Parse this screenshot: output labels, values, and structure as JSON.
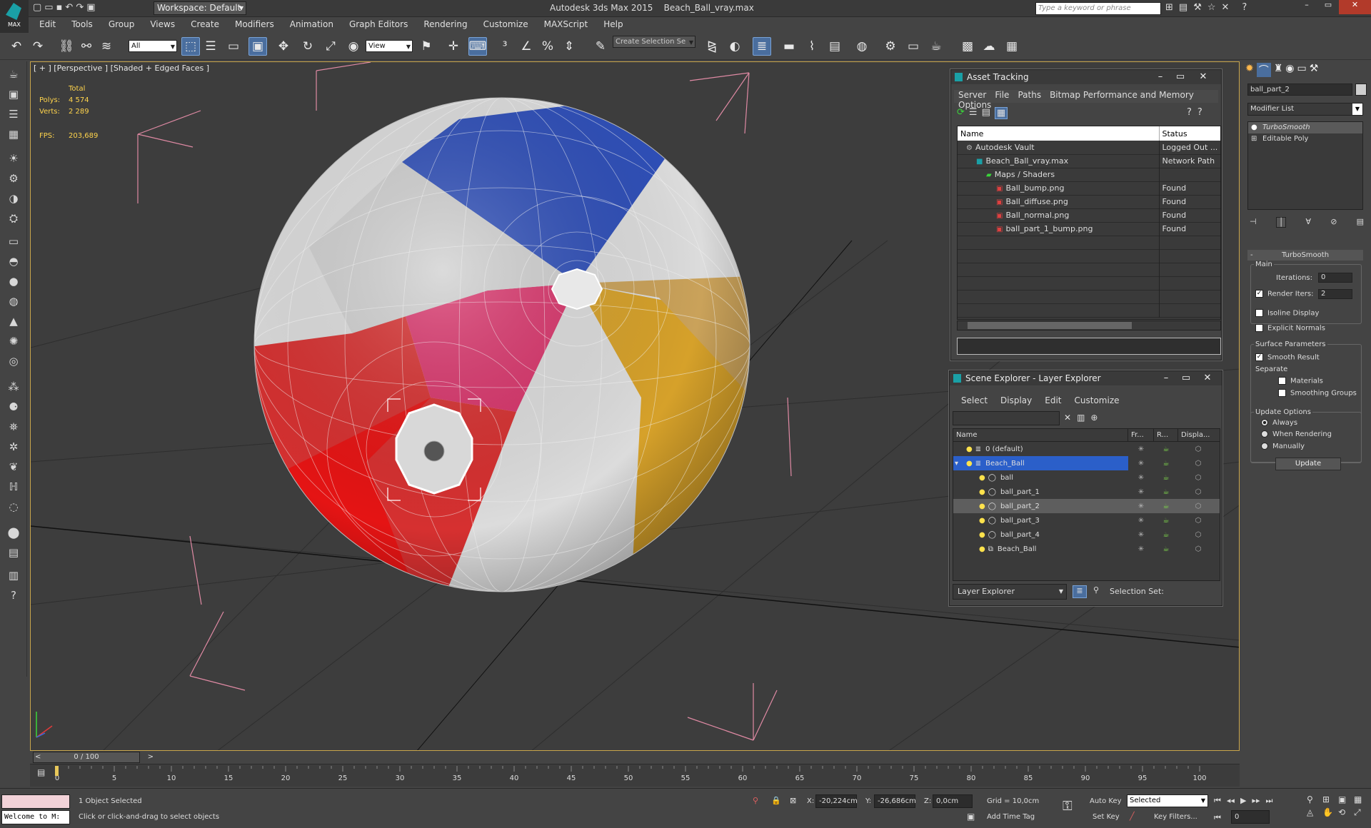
{
  "app": {
    "logo": "MAX",
    "title": "Autodesk 3ds Max  2015",
    "file": "Beach_Ball_vray.max",
    "workspace": "Workspace: Default",
    "search_placeholder": "Type a keyword or phrase"
  },
  "menu": [
    "Edit",
    "Tools",
    "Group",
    "Views",
    "Create",
    "Modifiers",
    "Animation",
    "Graph Editors",
    "Rendering",
    "Customize",
    "MAXScript",
    "Help"
  ],
  "toolbar": {
    "filter": "All",
    "ref_coord": "View",
    "selection_set": "Create Selection Se"
  },
  "viewport": {
    "label": "[ + ] [Perspective ] [Shaded + Edged Faces ]",
    "stats": {
      "total_label": "Total",
      "polys_label": "Polys:",
      "polys": "4 574",
      "verts_label": "Verts:",
      "verts": "2 289",
      "fps_label": "FPS:",
      "fps": "203,689"
    }
  },
  "asset_tracking": {
    "title": "Asset Tracking",
    "menu": [
      "Server",
      "File",
      "Paths",
      "Bitmap Performance and Memory",
      "Options"
    ],
    "columns": [
      "Name",
      "Status"
    ],
    "rows": [
      {
        "name": "Autodesk Vault",
        "status": "Logged Out ...",
        "indent": 0
      },
      {
        "name": "Beach_Ball_vray.max",
        "status": "Network Path",
        "indent": 1
      },
      {
        "name": "Maps / Shaders",
        "status": "",
        "indent": 2
      },
      {
        "name": "Ball_bump.png",
        "status": "Found",
        "indent": 3
      },
      {
        "name": "Ball_diffuse.png",
        "status": "Found",
        "indent": 3
      },
      {
        "name": "Ball_normal.png",
        "status": "Found",
        "indent": 3
      },
      {
        "name": "ball_part_1_bump.png",
        "status": "Found",
        "indent": 3
      }
    ]
  },
  "scene_explorer": {
    "title": "Scene Explorer - Layer Explorer",
    "menu": [
      "Select",
      "Display",
      "Edit",
      "Customize"
    ],
    "columns": [
      "Name",
      "Fr...",
      "R...",
      "Displa..."
    ],
    "rows": [
      {
        "name": "0 (default)",
        "indent": 0,
        "type": "layer"
      },
      {
        "name": "Beach_Ball",
        "indent": 0,
        "type": "layer",
        "selected": true
      },
      {
        "name": "ball",
        "indent": 1,
        "type": "object"
      },
      {
        "name": "ball_part_1",
        "indent": 1,
        "type": "object"
      },
      {
        "name": "ball_part_2",
        "indent": 1,
        "type": "object",
        "highlight": true
      },
      {
        "name": "ball_part_3",
        "indent": 1,
        "type": "object"
      },
      {
        "name": "ball_part_4",
        "indent": 1,
        "type": "object"
      },
      {
        "name": "Beach_Ball",
        "indent": 1,
        "type": "group"
      }
    ],
    "footer_dropdown": "Layer Explorer",
    "selection_set_label": "Selection Set:"
  },
  "command_panel": {
    "object_name": "ball_part_2",
    "modifier_list": "Modifier List",
    "stack": [
      "TurboSmooth",
      "Editable Poly"
    ],
    "rollout_title": "TurboSmooth",
    "main_label": "Main",
    "iterations_label": "Iterations:",
    "iterations": "0",
    "render_iters_label": "Render Iters:",
    "render_iters": "2",
    "isoline_label": "Isoline Display",
    "explicit_label": "Explicit Normals",
    "surface_label": "Surface Parameters",
    "smooth_result_label": "Smooth Result",
    "separate_label": "Separate",
    "materials_label": "Materials",
    "smoothing_label": "Smoothing Groups",
    "update_options_label": "Update Options",
    "always_label": "Always",
    "when_rendering_label": "When Rendering",
    "manually_label": "Manually",
    "update_button": "Update"
  },
  "timeline": {
    "frame": "0 / 100",
    "ticks": [
      "0",
      "5",
      "10",
      "15",
      "20",
      "25",
      "30",
      "35",
      "40",
      "45",
      "50",
      "55",
      "60",
      "65",
      "70",
      "75",
      "80",
      "85",
      "90",
      "95",
      "100"
    ]
  },
  "status": {
    "listener": "Welcome to M:",
    "selected": "1 Object Selected",
    "prompt": "Click or click-and-drag to select objects",
    "x_label": "X:",
    "x": "-20,224cm",
    "y_label": "Y:",
    "y": "-26,686cm",
    "z_label": "Z:",
    "z": "0,0cm",
    "grid": "Grid = 10,0cm",
    "add_time_tag": "Add Time Tag",
    "auto_key": "Auto Key",
    "set_key": "Set Key",
    "key_mode": "Selected",
    "key_filters": "Key Filters...",
    "frame_field": "0"
  }
}
